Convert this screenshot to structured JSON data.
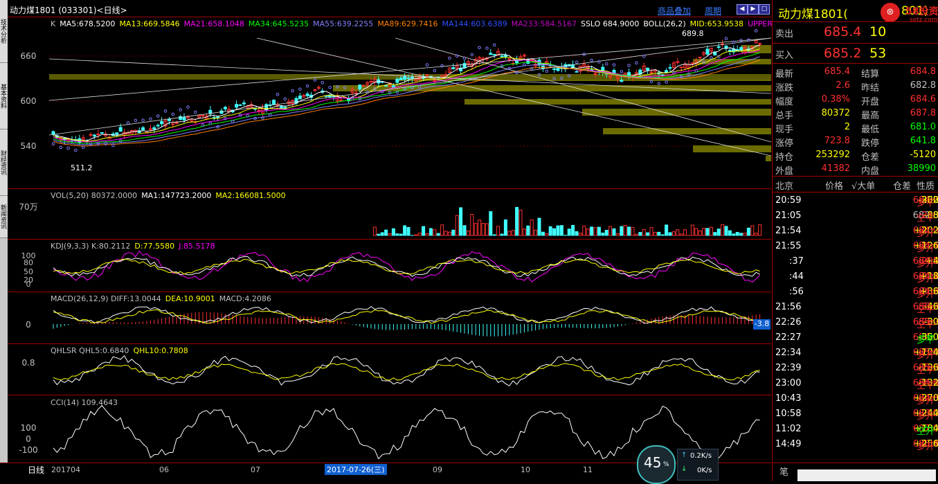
{
  "window": {
    "title": "动力煤1801 (033301)<日线>",
    "overlay_link": "商品叠加",
    "period_link": "周期"
  },
  "left_tabs": [
    "技术分析",
    "基本资料",
    "财经资讯",
    "新闻资讯"
  ],
  "main": {
    "legend": [
      {
        "text": "K",
        "color": "#c0c0c0"
      },
      {
        "text": "MA5:678.5200",
        "color": "#ffffff"
      },
      {
        "text": "MA13:669.5846",
        "color": "#ffff00"
      },
      {
        "text": "MA21:658.1048",
        "color": "#ff00ff"
      },
      {
        "text": "MA34:645.5235",
        "color": "#00ff00"
      },
      {
        "text": "MA55:639.2255",
        "color": "#8080ff"
      },
      {
        "text": "MA89:629.7416",
        "color": "#ff8000"
      },
      {
        "text": "MA144:603.6389",
        "color": "#3050ff"
      },
      {
        "text": "MA233:584.5167",
        "color": "#c000c0"
      },
      {
        "text": "SSLO 684.9000",
        "color": "#ffffff"
      },
      {
        "text": "BOLL(26,2)",
        "color": "#ffffff"
      },
      {
        "text": "MID:653.9538",
        "color": "#ffff00"
      },
      {
        "text": "UPPER",
        "color": "#ff00ff"
      }
    ],
    "y_ticks": [
      "660",
      "600",
      "540"
    ],
    "high_label": "689.8",
    "low_label": "511.2"
  },
  "vol": {
    "legend": [
      {
        "text": "VOL(5,20) 80372.0000",
        "color": "#c0c0c0"
      },
      {
        "text": "MA1:147723.2000",
        "color": "#ffffff"
      },
      {
        "text": "MA2:166081.5000",
        "color": "#ffff00"
      }
    ],
    "y_tick": "70万"
  },
  "kdj": {
    "legend": [
      {
        "text": "KDJ(9,3,3) K:80.2112",
        "color": "#c0c0c0"
      },
      {
        "text": "D:77.5580",
        "color": "#ffff00"
      },
      {
        "text": "J:85.5178",
        "color": "#ff00ff"
      }
    ],
    "y_ticks": [
      "100",
      "80",
      "50",
      "20",
      "0"
    ]
  },
  "macd": {
    "legend": [
      {
        "text": "MACD(26,12,9) DIFF:13.0044",
        "color": "#c0c0c0"
      },
      {
        "text": "DEA:10.9001",
        "color": "#ffff00"
      },
      {
        "text": "MACD:4.2086",
        "color": "#c0c0c0"
      }
    ],
    "y_tick": "0",
    "cursor_value": "-3.8"
  },
  "qhl": {
    "legend": [
      {
        "text": "QHLSR QHL5:0.6840",
        "color": "#c0c0c0"
      },
      {
        "text": "QHL10:0.7808",
        "color": "#ffff00"
      }
    ],
    "y_tick": "0.8"
  },
  "cci": {
    "legend": [
      {
        "text": "CCI(14) 109.4643",
        "color": "#c0c0c0"
      }
    ],
    "y_ticks": [
      "100",
      "0",
      "-100"
    ]
  },
  "bottom": {
    "period_label": "日线",
    "date_labels": [
      "201704",
      "06",
      "07",
      "09",
      "10",
      "11"
    ],
    "cursor_date": "2017-07-26(三)",
    "gauge_pct": "45",
    "gauge_unit": "%",
    "up_speed": "0.2K/s",
    "down_speed": "0K/s"
  },
  "quote": {
    "name": "动力煤1801(",
    "name_tail": "801)",
    "logo_text": "58投资",
    "logo_sub": "setz.com",
    "sell": {
      "label": "卖出",
      "price": "685.4",
      "vol": "10"
    },
    "buy": {
      "label": "买入",
      "price": "685.2",
      "vol": "53"
    },
    "rows": [
      {
        "l1": "最新",
        "v1": "685.4",
        "c1": "#ff3030",
        "l2": "结算",
        "v2": "684.8",
        "c2": "#ff3030"
      },
      {
        "l1": "涨跌",
        "v1": "2.6",
        "c1": "#ff3030",
        "l2": "昨结",
        "v2": "682.8",
        "c2": "#c0c0c0"
      },
      {
        "l1": "幅度",
        "v1": "0.38%",
        "c1": "#ff3030",
        "l2": "开盘",
        "v2": "684.6",
        "c2": "#ff3030"
      },
      {
        "l1": "总手",
        "v1": "80372",
        "c1": "#ffff00",
        "l2": "最高",
        "v2": "687.8",
        "c2": "#ff3030"
      },
      {
        "l1": "现手",
        "v1": "2",
        "c1": "#ffff00",
        "l2": "最低",
        "v2": "681.0",
        "c2": "#00ff00"
      },
      {
        "l1": "涨停",
        "v1": "723.8",
        "c1": "#ff3030",
        "l2": "跌停",
        "v2": "641.8",
        "c2": "#00ff00"
      },
      {
        "l1": "持仓",
        "v1": "253292",
        "c1": "#ffff00",
        "l2": "仓差",
        "v2": "-5120",
        "c2": "#ffff00"
      },
      {
        "l1": "外盘",
        "v1": "41382",
        "c1": "#ff3030",
        "l2": "内盘",
        "v2": "38990",
        "c2": "#00ff00"
      }
    ],
    "tick_header": {
      "time": "北京",
      "price": "价格",
      "vol": "√大单",
      "diff": "仓差",
      "nature": "性质"
    },
    "ticks": [
      {
        "t": "20:59",
        "p": "684.6",
        "v": "330",
        "d": "-262",
        "n": "多平",
        "pc": "#ff3030",
        "vc": "#ffff00",
        "dc": "#ffff00",
        "nc": "#ff3030"
      },
      {
        "t": "21:05",
        "p": "682.8",
        "v": "210",
        "d": "-88",
        "n": "空平",
        "pc": "#c0c0c0",
        "vc": "#ff3030",
        "dc": "#ffff00",
        "nc": "#ff3030"
      },
      {
        "t": "21:54",
        "p": "684.0",
        "v": "400",
        "d": "+202",
        "n": "多开",
        "pc": "#ff3030",
        "vc": "#ff3030",
        "dc": "#ffff00",
        "nc": "#ff3030"
      },
      {
        "t": "21:55",
        "p": "684.4",
        "v": "204",
        "d": "+126",
        "n": "多开",
        "pc": "#ff3030",
        "vc": "#ff3030",
        "dc": "#ffff00",
        "nc": "#ff3030"
      },
      {
        "t": ":37",
        "p": "684.8",
        "v": "202",
        "d": "+4",
        "n": "多开",
        "pc": "#ff3030",
        "vc": "#ff3030",
        "dc": "#ffff00",
        "nc": "#ff3030"
      },
      {
        "t": ":44",
        "p": "684.4",
        "v": "202",
        "d": "+18",
        "n": "多开",
        "pc": "#ff3030",
        "vc": "#ff3030",
        "dc": "#ffff00",
        "nc": "#ff3030"
      },
      {
        "t": ":56",
        "p": "684.8",
        "v": "202",
        "d": "+36",
        "n": "多开",
        "pc": "#ff3030",
        "vc": "#ff3030",
        "dc": "#ffff00",
        "nc": "#ff3030"
      },
      {
        "t": "21:56",
        "p": "685.0",
        "v": "352",
        "d": "-46",
        "n": "空平",
        "pc": "#ff3030",
        "vc": "#ff3030",
        "dc": "#ffff00",
        "nc": "#ff3030"
      },
      {
        "t": "22:26",
        "p": "685.0",
        "v": "202",
        "d": "-30",
        "n": "空平",
        "pc": "#ff3030",
        "vc": "#ff3030",
        "dc": "#ffff00",
        "nc": "#ff3030"
      },
      {
        "t": "22:27",
        "p": "684.0",
        "v": "500",
        "d": "-350",
        "n": "多平",
        "pc": "#ff3030",
        "vc": "#00ff00",
        "dc": "#ffff00",
        "nc": "#00ff00"
      },
      {
        "t": "22:34",
        "p": "685.8",
        "v": "270",
        "d": "+104",
        "n": "多开",
        "pc": "#ff3030",
        "vc": "#ff3030",
        "dc": "#ffff00",
        "nc": "#ff3030"
      },
      {
        "t": "22:39",
        "p": "685.2",
        "v": "200",
        "d": "-136",
        "n": "空平",
        "pc": "#ff3030",
        "vc": "#ff3030",
        "dc": "#ffff00",
        "nc": "#ff3030"
      },
      {
        "t": "23:00",
        "p": "684.8",
        "v": "234",
        "d": "-132",
        "n": "空平",
        "pc": "#ff3030",
        "vc": "#ff3030",
        "dc": "#ffff00",
        "nc": "#ff3030"
      },
      {
        "t": "10:43",
        "p": "684.8",
        "v": "306",
        "d": "+270",
        "n": "多开",
        "pc": "#ff3030",
        "vc": "#ff3030",
        "dc": "#ffff00",
        "nc": "#ff3030"
      },
      {
        "t": "10:58",
        "p": "686.0",
        "v": "262",
        "d": "+244",
        "n": "多开",
        "pc": "#ff3030",
        "vc": "#ff3030",
        "dc": "#ffff00",
        "nc": "#ff3030"
      },
      {
        "t": "11:02",
        "p": "687.0",
        "v": "204",
        "d": "+184",
        "n": "空开",
        "pc": "#ff3030",
        "vc": "#00ff00",
        "dc": "#ffff00",
        "nc": "#00ff00"
      },
      {
        "t": "14:49",
        "p": "686.4",
        "v": "408",
        "d": "+256",
        "n": "多开",
        "pc": "#ff3030",
        "vc": "#ff3030",
        "dc": "#ffff00",
        "nc": "#ff3030"
      }
    ],
    "footer_label": "笔"
  }
}
